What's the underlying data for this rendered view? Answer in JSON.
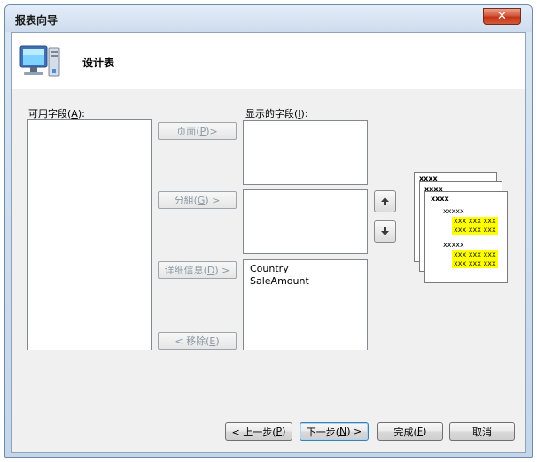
{
  "window": {
    "title": "报表向导",
    "close_glyph": "✕"
  },
  "header": {
    "title": "设计表",
    "icon": "computer-icon"
  },
  "available_fields": {
    "label": "可用字段(",
    "accel": "A",
    "label_end": "):",
    "items": []
  },
  "displayed_fields": {
    "label": "显示的字段(",
    "accel": "I",
    "label_end": "):"
  },
  "page_list": {
    "items": []
  },
  "group_list": {
    "items": []
  },
  "detail_list": {
    "items": [
      "Country",
      "SaleAmount"
    ]
  },
  "move_buttons": {
    "page": {
      "pre": "页面(",
      "accel": "P",
      "post": ")>"
    },
    "group": {
      "pre": "分組(",
      "accel": "G",
      "post": ") >"
    },
    "detail": {
      "pre": "详细信息(",
      "accel": "D",
      "post": ") >"
    },
    "remove": {
      "pre": "< 移除(",
      "accel": "E",
      "post": ")"
    }
  },
  "order_buttons": {
    "up_icon": "arrow-up-icon",
    "down_icon": "arrow-down-icon"
  },
  "preview": {
    "page_label": "xxxx",
    "group_label": "xxxx",
    "detail_label": "xxxxx",
    "row": "xxx xxx xxx"
  },
  "footer": {
    "back": {
      "pre": "< 上一步(",
      "accel": "P",
      "post": ")"
    },
    "next": {
      "pre": "下一步(",
      "accel": "N",
      "post": ") >"
    },
    "finish": {
      "pre": "完成(",
      "accel": "F",
      "post": ")"
    },
    "cancel": {
      "label": "取消"
    }
  }
}
